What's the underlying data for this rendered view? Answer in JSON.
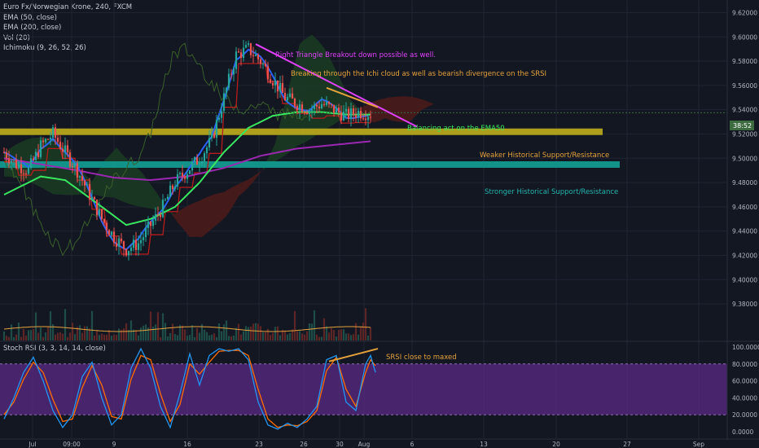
{
  "colors": {
    "background": "#131722",
    "grid": "#1f2433",
    "up": "#26a69a",
    "down": "#ef5350",
    "ema50": "#39e75f",
    "ema200": "#9c27b0",
    "tenkan": "#2962ff",
    "kijun": "#b71c1c",
    "lagging": "#3a5f2a",
    "cloud_bull": "#1b3a24",
    "cloud_bear": "#4a1b1b",
    "weak_zone": "#b5a51c",
    "strong_zone": "#12998f",
    "annot_magenta": "#e040fb",
    "annot_orange": "#e5a23c",
    "annot_green": "#39e75f",
    "annot_teal": "#22b5ad",
    "rsi_band": "#5b2a86",
    "rsi_k": "#2196f3",
    "rsi_d": "#ff6d00"
  },
  "header": {
    "symbol": "Euro Fx/Norwegian Krone, 240, FXCM",
    "indicators": [
      "EMA (50, close)",
      "EMA (200, close)",
      "Vol (20)",
      "Ichimoku (9, 26, 52, 26)"
    ],
    "rsi_title": "Stoch RSI (3, 3, 14, 14, close)"
  },
  "chart_data": [
    {
      "type": "candlestick",
      "title": "Euro Fx/Norwegian Krone, 240, FXCM",
      "x_ticks": [
        "Jul",
        "09:00",
        "9",
        "16",
        "23",
        "26",
        "30",
        "Aug",
        "6",
        "13",
        "20",
        "27",
        "Sep"
      ],
      "y_ticks": [
        "9.62000",
        "9.60000",
        "9.58000",
        "9.56000",
        "9.54000",
        "9.52000",
        "9.50000",
        "9.48000",
        "9.46000",
        "9.44000",
        "9.42000",
        "9.40000",
        "9.38000"
      ],
      "ylim": [
        9.37,
        9.625
      ],
      "last_price_label": "38:52",
      "last_price": 9.5375,
      "close_path": [
        [
          0,
          9.505
        ],
        [
          5,
          9.495
        ],
        [
          10,
          9.49
        ],
        [
          15,
          9.51
        ],
        [
          20,
          9.52
        ],
        [
          25,
          9.505
        ],
        [
          30,
          9.49
        ],
        [
          35,
          9.47
        ],
        [
          40,
          9.45
        ],
        [
          45,
          9.435
        ],
        [
          50,
          9.425
        ],
        [
          55,
          9.43
        ],
        [
          60,
          9.445
        ],
        [
          65,
          9.46
        ],
        [
          70,
          9.48
        ],
        [
          75,
          9.49
        ],
        [
          80,
          9.5
        ],
        [
          85,
          9.515
        ],
        [
          90,
          9.55
        ],
        [
          95,
          9.585
        ],
        [
          100,
          9.59
        ],
        [
          105,
          9.58
        ],
        [
          110,
          9.565
        ],
        [
          115,
          9.55
        ],
        [
          120,
          9.545
        ],
        [
          125,
          9.54
        ],
        [
          130,
          9.545
        ],
        [
          135,
          9.54
        ],
        [
          140,
          9.535
        ],
        [
          145,
          9.538
        ],
        [
          150,
          9.537
        ]
      ],
      "ema50": [
        [
          0,
          9.47
        ],
        [
          15,
          9.485
        ],
        [
          25,
          9.482
        ],
        [
          40,
          9.46
        ],
        [
          50,
          9.445
        ],
        [
          60,
          9.45
        ],
        [
          70,
          9.46
        ],
        [
          80,
          9.48
        ],
        [
          90,
          9.505
        ],
        [
          100,
          9.525
        ],
        [
          110,
          9.535
        ],
        [
          120,
          9.538
        ],
        [
          130,
          9.538
        ],
        [
          140,
          9.536
        ],
        [
          150,
          9.536
        ]
      ],
      "ema200": [
        [
          0,
          9.5
        ],
        [
          15,
          9.495
        ],
        [
          30,
          9.49
        ],
        [
          45,
          9.484
        ],
        [
          60,
          9.482
        ],
        [
          75,
          9.485
        ],
        [
          90,
          9.492
        ],
        [
          105,
          9.502
        ],
        [
          120,
          9.508
        ],
        [
          135,
          9.511
        ],
        [
          150,
          9.514
        ]
      ],
      "zones": [
        {
          "name": "Weaker Historical Support/Resistance",
          "from": 9.5205,
          "to": 9.5245,
          "x_end": 245
        },
        {
          "name": "Stronger Historical Support/Resistance",
          "from": 9.4935,
          "to": 9.4975,
          "x_end": 252
        }
      ],
      "annotations": [
        {
          "text": "Right Triangle Breakout down possible as well.",
          "color": "annot_magenta"
        },
        {
          "text": "Breaking through the Ichi cloud as well as bearish divergence on the SRSI",
          "color": "annot_orange"
        },
        {
          "text": "Balancing act on the EMA50",
          "color": "annot_green"
        },
        {
          "text": "Weaker Historical Support/Resistance",
          "color": "annot_orange"
        },
        {
          "text": "Stronger Historical Support/Resistance",
          "color": "annot_teal"
        }
      ],
      "trendlines": [
        {
          "name": "triangle-upper",
          "from": [
            103,
            9.594
          ],
          "to": [
            169,
            9.526
          ],
          "color": "annot_magenta"
        },
        {
          "name": "divergence-price",
          "from": [
            132,
            9.558
          ],
          "to": [
            153,
            9.542
          ],
          "color": "annot_orange"
        }
      ]
    },
    {
      "type": "line",
      "title": "Stoch RSI (3, 3, 14, 14, close)",
      "y_ticks": [
        "100.0000",
        "80.0000",
        "60.0000",
        "40.0000",
        "20.0000",
        "0.0000"
      ],
      "ylim": [
        0,
        100
      ],
      "band": [
        20,
        80
      ],
      "annotation": {
        "text": "SRSI close to maxed",
        "color": "annot_orange"
      },
      "k_line": [
        [
          0,
          15
        ],
        [
          4,
          40
        ],
        [
          8,
          70
        ],
        [
          12,
          88
        ],
        [
          16,
          60
        ],
        [
          20,
          25
        ],
        [
          24,
          5
        ],
        [
          28,
          20
        ],
        [
          32,
          65
        ],
        [
          36,
          82
        ],
        [
          40,
          40
        ],
        [
          44,
          8
        ],
        [
          48,
          20
        ],
        [
          52,
          75
        ],
        [
          56,
          98
        ],
        [
          60,
          75
        ],
        [
          64,
          30
        ],
        [
          68,
          5
        ],
        [
          72,
          45
        ],
        [
          76,
          92
        ],
        [
          80,
          55
        ],
        [
          84,
          90
        ],
        [
          88,
          98
        ],
        [
          92,
          95
        ],
        [
          96,
          98
        ],
        [
          100,
          85
        ],
        [
          104,
          35
        ],
        [
          108,
          8
        ],
        [
          112,
          3
        ],
        [
          116,
          10
        ],
        [
          120,
          5
        ],
        [
          124,
          15
        ],
        [
          128,
          30
        ],
        [
          132,
          85
        ],
        [
          136,
          90
        ],
        [
          140,
          35
        ],
        [
          144,
          25
        ],
        [
          148,
          80
        ],
        [
          150,
          90
        ],
        [
          152,
          70
        ]
      ],
      "d_line": [
        [
          0,
          20
        ],
        [
          4,
          35
        ],
        [
          8,
          62
        ],
        [
          12,
          82
        ],
        [
          16,
          70
        ],
        [
          20,
          38
        ],
        [
          24,
          12
        ],
        [
          28,
          15
        ],
        [
          32,
          52
        ],
        [
          36,
          78
        ],
        [
          40,
          55
        ],
        [
          44,
          18
        ],
        [
          48,
          15
        ],
        [
          52,
          62
        ],
        [
          56,
          90
        ],
        [
          60,
          85
        ],
        [
          64,
          45
        ],
        [
          68,
          12
        ],
        [
          72,
          32
        ],
        [
          76,
          80
        ],
        [
          80,
          68
        ],
        [
          84,
          82
        ],
        [
          88,
          95
        ],
        [
          92,
          96
        ],
        [
          96,
          96
        ],
        [
          100,
          90
        ],
        [
          104,
          50
        ],
        [
          108,
          15
        ],
        [
          112,
          5
        ],
        [
          116,
          8
        ],
        [
          120,
          7
        ],
        [
          124,
          12
        ],
        [
          128,
          25
        ],
        [
          132,
          72
        ],
        [
          136,
          88
        ],
        [
          140,
          50
        ],
        [
          144,
          30
        ],
        [
          148,
          70
        ],
        [
          150,
          85
        ],
        [
          152,
          78
        ]
      ],
      "divergence_line": {
        "from": [
          133,
          83
        ],
        "to": [
          153,
          98
        ]
      }
    }
  ]
}
